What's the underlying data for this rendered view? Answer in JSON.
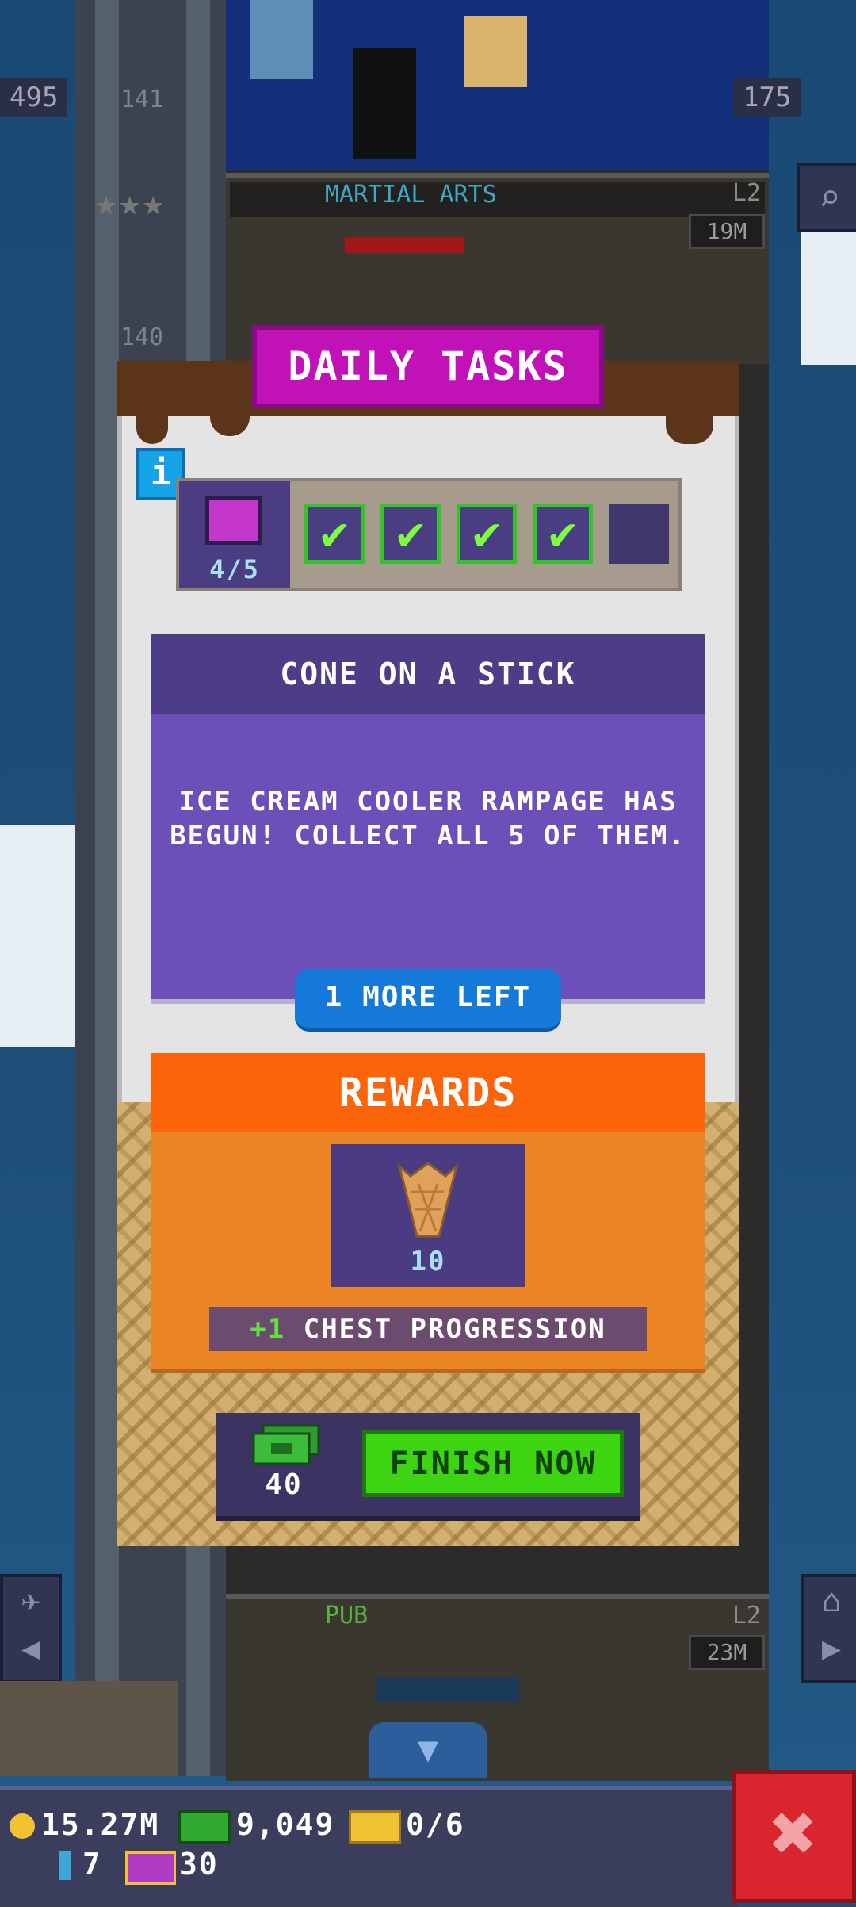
{
  "background": {
    "left_badge": "495",
    "floor_number": "141",
    "right_badge": "175",
    "floor_below": "140",
    "top_floor": {
      "name": "MARTIAL ARTS",
      "level": "L2",
      "population": "19M"
    },
    "bottom_floor": {
      "name": "PUB",
      "level": "L2",
      "population": "23M"
    }
  },
  "dialog": {
    "title": "DAILY TASKS",
    "info_label": "i",
    "progress": {
      "count": "4/5",
      "completed": 4,
      "total": 5,
      "checkmark": "✔"
    },
    "task": {
      "title": "CONE ON A STICK",
      "description": "ICE CREAM COOLER RAMPAGE HAS BEGUN! COLLECT ALL 5 OF THEM.",
      "remaining": "1 MORE LEFT"
    },
    "rewards": {
      "title": "REWARDS",
      "item_icon": "ice-cream-cone-icon",
      "item_count": "10",
      "bonus_plus": "+1",
      "bonus_text": "CHEST PROGRESSION"
    },
    "finish": {
      "cost": "40",
      "button_label": "FINISH NOW"
    }
  },
  "hud": {
    "coins": "15.27M",
    "bux": "9,049",
    "tickets": "0/6",
    "keys": "7",
    "gold_tickets": "30"
  },
  "close_label": "✖",
  "colors": {
    "title": "#c112b8",
    "task_card": "#6c4fb8",
    "rewards": "#ea8424",
    "finish_button": "#3dd412",
    "close_button": "#d9262e"
  }
}
